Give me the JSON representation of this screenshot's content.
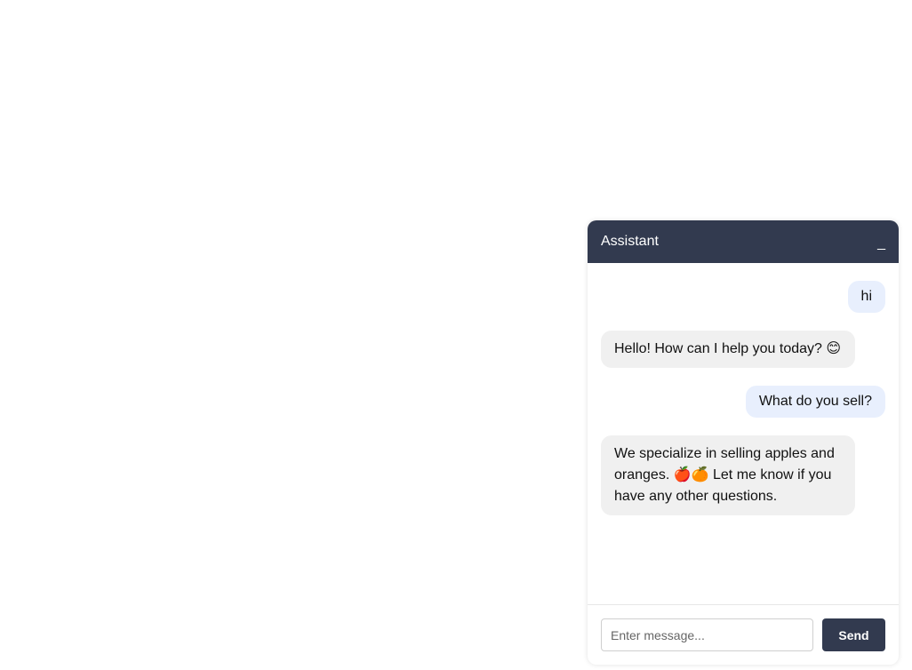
{
  "chat": {
    "title": "Assistant",
    "minimize_label": "_",
    "messages": [
      {
        "role": "user",
        "text": "hi"
      },
      {
        "role": "assistant",
        "text": "Hello!  How can I help you today? 😊"
      },
      {
        "role": "user",
        "text": "What do you sell?"
      },
      {
        "role": "assistant",
        "text": "We specialize in selling apples and oranges.  🍎🍊  Let me know if you have any other questions."
      }
    ],
    "input": {
      "placeholder": "Enter message...",
      "value": ""
    },
    "send_label": "Send"
  },
  "colors": {
    "header_bg": "#323a4f",
    "user_bubble": "#e8effd",
    "assistant_bubble": "#f0f0f0",
    "send_button": "#323a4f"
  },
  "icons": {
    "minimize": "minimize-icon"
  }
}
